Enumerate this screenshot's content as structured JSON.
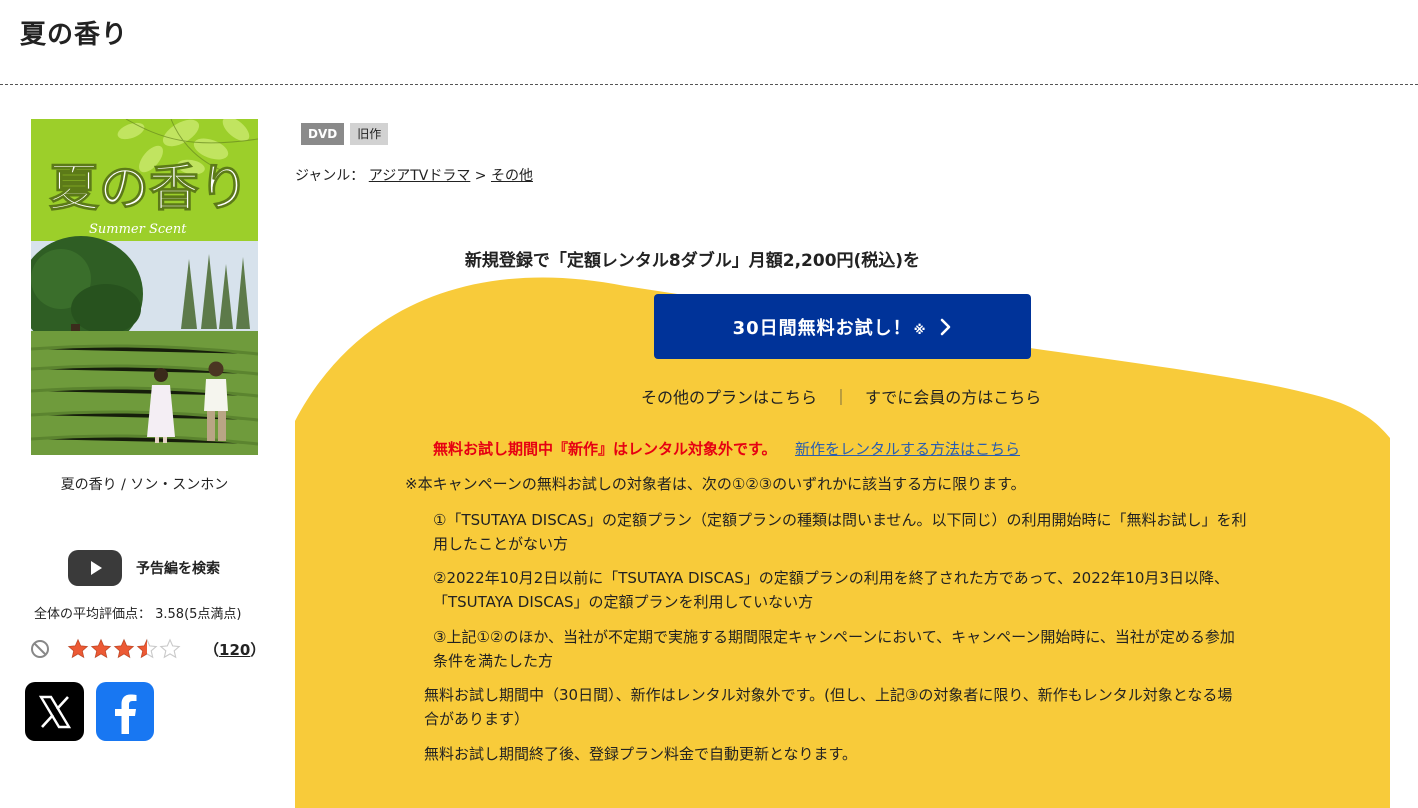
{
  "page": {
    "title": "夏の香り"
  },
  "poster": {
    "title_text": "夏の香り",
    "subtitle_text": "Summer Scent",
    "caption": "夏の香り / ソン・スンホン"
  },
  "trailer": {
    "label": "予告編を検索",
    "icon": "youtube-play-icon"
  },
  "rating": {
    "average_text": "全体の平均評価点： 3.58(5点満点)",
    "value": 3.58,
    "max": 5,
    "review_count": "120",
    "count_open": "（",
    "count_close": "）"
  },
  "share": {
    "x_icon": "x-logo-icon",
    "facebook_icon": "facebook-logo-icon"
  },
  "tags": [
    {
      "label": "DVD"
    },
    {
      "label": "旧作"
    }
  ],
  "genre": {
    "label": "ジャンル：",
    "items": [
      {
        "label": "アジアTVドラマ"
      },
      {
        "label": "その他"
      }
    ],
    "separator": ">"
  },
  "promo": {
    "heading": "新規登録で「定額レンタル8ダブル」月額2,200円(税込)を",
    "cta_label": "30日間無料お試し！",
    "cta_note": "※",
    "other_plans": "その他のプランはこちら",
    "separator": "｜",
    "member_link": "すでに会員の方はこちら",
    "warning": "無料お試し期間中『新作』はレンタル対象外です。",
    "warning_link": "新作をレンタルする方法はこちら",
    "eligibility_intro": "※本キャンペーンの無料お試しの対象者は、次の①②③のいずれかに該当する方に限ります。",
    "conditions": [
      {
        "line1": "①「TSUTAYA DISCAS」の定額プラン（定額プランの種類は問いません。以下同じ）の利用開始時に「無料お試し」を利",
        "line2": "用したことがない方"
      },
      {
        "line1": "②2022年10月2日以前に「TSUTAYA DISCAS」の定額プランの利用を終了された方であって、2022年10月3日以降、",
        "line2": "「TSUTAYA DISCAS」の定額プランを利用していない方"
      },
      {
        "line1": "③上記①②のほか、当社が不定期で実施する期間限定キャンペーンにおいて、キャンペーン開始時に、当社が定める参加",
        "line2": "条件を満たした方"
      }
    ],
    "note_new_line1": "無料お試し期間中（30日間）、新作はレンタル対象外です。(但し、上記③の対象者に限り、新作もレンタル対象となる場",
    "note_new_line2": "合があります）",
    "note_renewal": "無料お試し期間終了後、登録プラン料金で自動更新となります。"
  },
  "colors": {
    "panel_yellow": "#f8cb3a",
    "cta_blue": "#003399",
    "warning_red": "#e60012",
    "link_blue": "#2a5db0",
    "facebook_blue": "#1877f2"
  }
}
